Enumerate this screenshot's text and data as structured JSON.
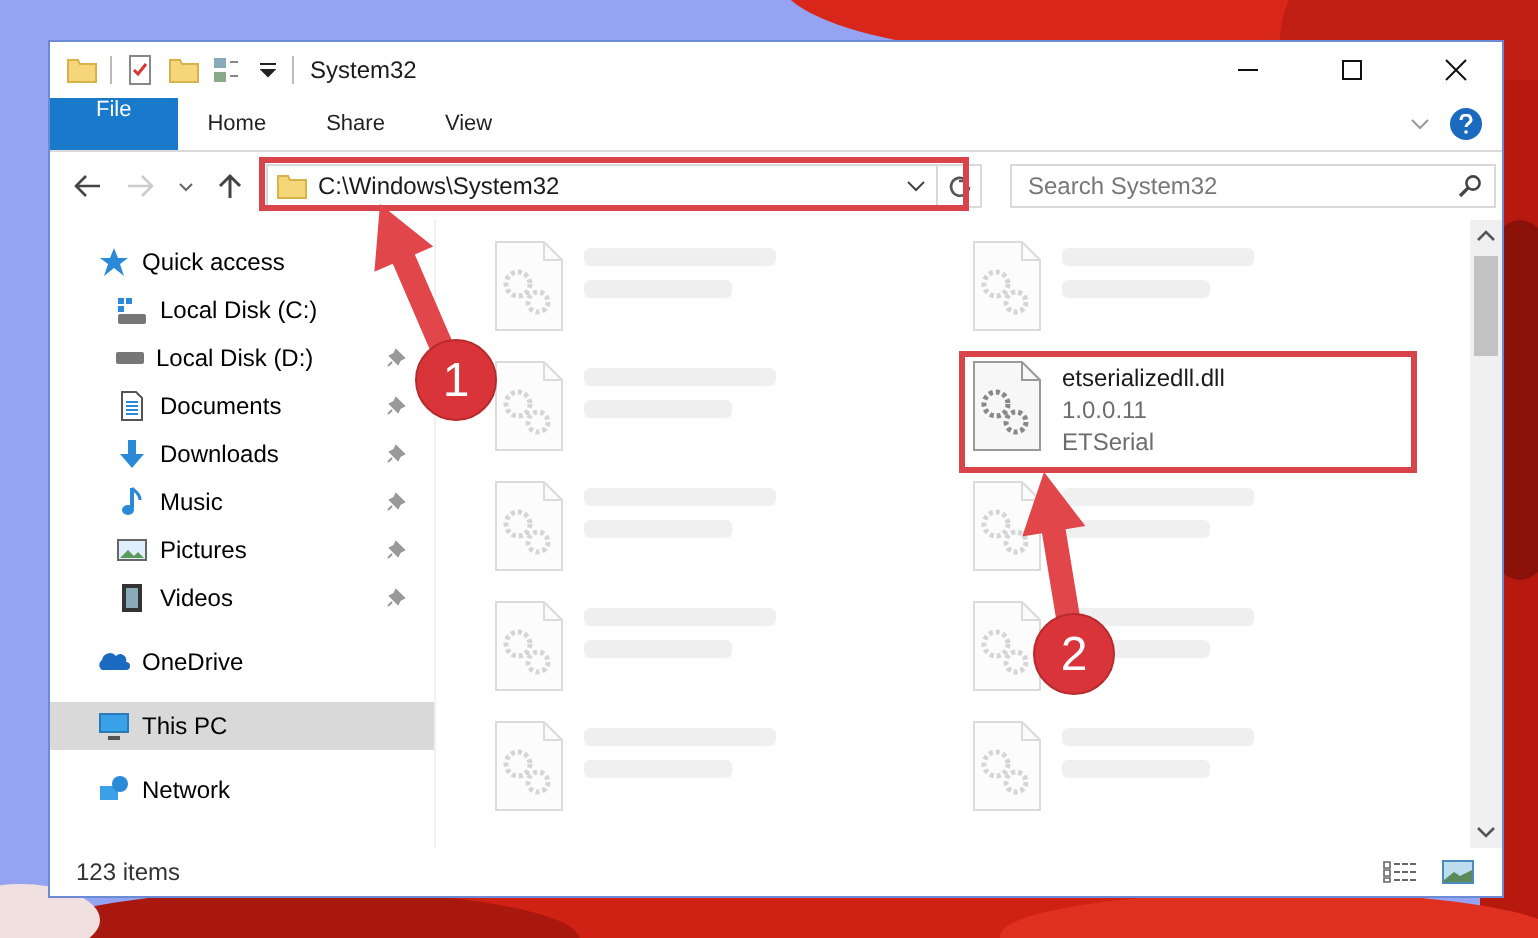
{
  "window": {
    "title": "System32"
  },
  "ribbon": {
    "tabs": [
      {
        "label": "File",
        "kind": "file"
      },
      {
        "label": "Home",
        "kind": "tab"
      },
      {
        "label": "Share",
        "kind": "tab"
      },
      {
        "label": "View",
        "kind": "tab"
      }
    ]
  },
  "address": {
    "path": "C:\\Windows\\System32"
  },
  "search": {
    "placeholder": "Search System32"
  },
  "nav": [
    {
      "label": "Quick access",
      "kind": "star",
      "selected": false,
      "children": [
        {
          "label": "Local Disk (C:)",
          "kind": "windows-drive",
          "pinned": false
        },
        {
          "label": "Local Disk (D:)",
          "kind": "drive",
          "pinned": true
        },
        {
          "label": "Documents",
          "kind": "documents",
          "pinned": true
        },
        {
          "label": "Downloads",
          "kind": "downloads",
          "pinned": true
        },
        {
          "label": "Music",
          "kind": "music",
          "pinned": true
        },
        {
          "label": "Pictures",
          "kind": "pictures",
          "pinned": true
        },
        {
          "label": "Videos",
          "kind": "videos",
          "pinned": true
        }
      ]
    },
    {
      "label": "OneDrive",
      "kind": "cloud",
      "selected": false
    },
    {
      "label": "This PC",
      "kind": "pc",
      "selected": true
    },
    {
      "label": "Network",
      "kind": "network",
      "selected": false
    }
  ],
  "files": [
    {
      "blurred": true
    },
    {
      "blurred": true
    },
    {
      "blurred": true
    },
    {
      "name": "etserializedll.dll",
      "lines": [
        "1.0.0.11",
        "ETSerial"
      ],
      "blurred": false
    },
    {
      "blurred": true
    },
    {
      "blurred": true
    },
    {
      "blurred": true
    },
    {
      "blurred": true
    },
    {
      "blurred": true
    },
    {
      "blurred": true
    }
  ],
  "status_bar": {
    "count": "123 items"
  },
  "annotations": [
    {
      "label": "1"
    },
    {
      "label": "2"
    }
  ]
}
